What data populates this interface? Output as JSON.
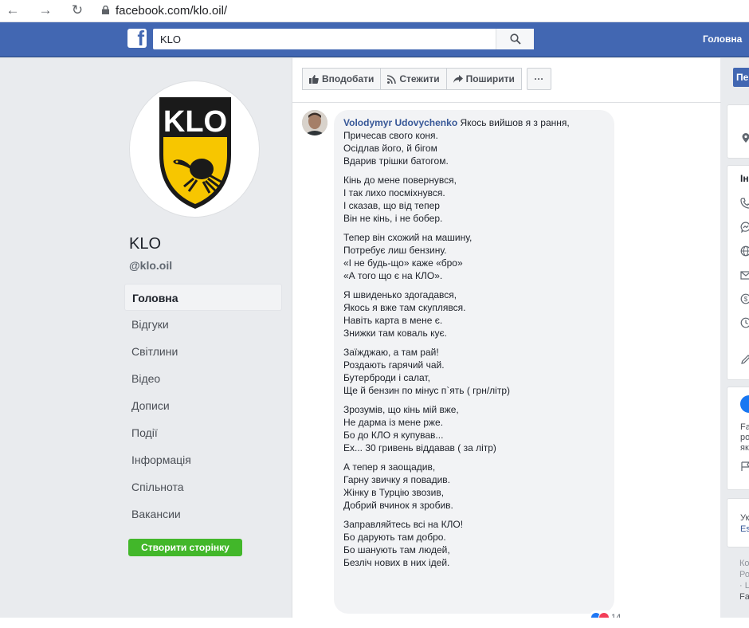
{
  "browser": {
    "back": "←",
    "forward": "→",
    "reload": "↻",
    "url": "facebook.com/klo.oil/"
  },
  "header": {
    "logo": "f",
    "search_value": "KLO",
    "home_label": "Головна"
  },
  "profile": {
    "logo_text": "KLO",
    "trademark": "TM",
    "name": "KLO",
    "handle": "@klo.oil"
  },
  "nav": {
    "items": [
      {
        "label": "Головна",
        "active": true
      },
      {
        "label": "Відгуки"
      },
      {
        "label": "Світлини"
      },
      {
        "label": "Відео"
      },
      {
        "label": "Дописи"
      },
      {
        "label": "Події"
      },
      {
        "label": "Інформація"
      },
      {
        "label": "Спільнота"
      },
      {
        "label": "Вакансии"
      }
    ],
    "create_page": "Створити сторінку"
  },
  "actions": {
    "like": "Вподобати",
    "follow": "Стежити",
    "share": "Поширити",
    "more": "···"
  },
  "comment": {
    "author": "Volodymyr Udovychenko",
    "first_line": "Якось вийшов я з рання,",
    "stanzas": [
      [
        "Причесав свого коня.",
        "Осідлав його, й бігом",
        "Вдарив трішки батогом."
      ],
      [
        "Кінь до мене повернувся,",
        "І так лихо посміхнувся.",
        "І сказав, що від тепер",
        "Він не кінь, і не бобер."
      ],
      [
        "Тепер він схожий на машину,",
        "Потребує лиш бензину.",
        "«І не будь-що» каже «бро»",
        "«А того що є на КЛО»."
      ],
      [
        "Я швиденько здогадався,",
        "Якось я вже там скуплявся.",
        "Навіть карта в мене є.",
        "Знижки там коваль кує."
      ],
      [
        "Заїжджаю, а там рай!",
        "Роздають гарячий чай.",
        "Бутерброди і салат,",
        "Ще й бензин по мінус п`ять ( грн/літр)"
      ],
      [
        "Зрозумів, що кінь мій вже,",
        "Не дарма із мене рже.",
        "Бо до КЛО я купував...",
        "Ех... 30 гривень віддавав ( за літр)"
      ],
      [
        "А тепер я заощадив,",
        "Гарну звичку я повадив.",
        "Жінку в Турцію звозив,",
        "Добрий вчинок я зробив."
      ],
      [
        "Заправляйтесь всі на КЛО!",
        "Бо дарують там добро.",
        "Бо шанують там людей,",
        "Безліч нових в них ідей."
      ]
    ],
    "reaction_count": "14"
  },
  "right": {
    "button_label": "Пе",
    "info_heading": "Ін",
    "promo_lines": [
      "Fa",
      "ро",
      "які"
    ],
    "ad_lines": [
      "Ук",
      "Es"
    ],
    "footer_lines": [
      "Ко",
      "Ро",
      "· Ц",
      "Fa"
    ]
  },
  "colors": {
    "brand_blue": "#4267b2",
    "link_blue": "#385898",
    "create_green": "#42b72a",
    "klo_yellow": "#f7c600"
  }
}
